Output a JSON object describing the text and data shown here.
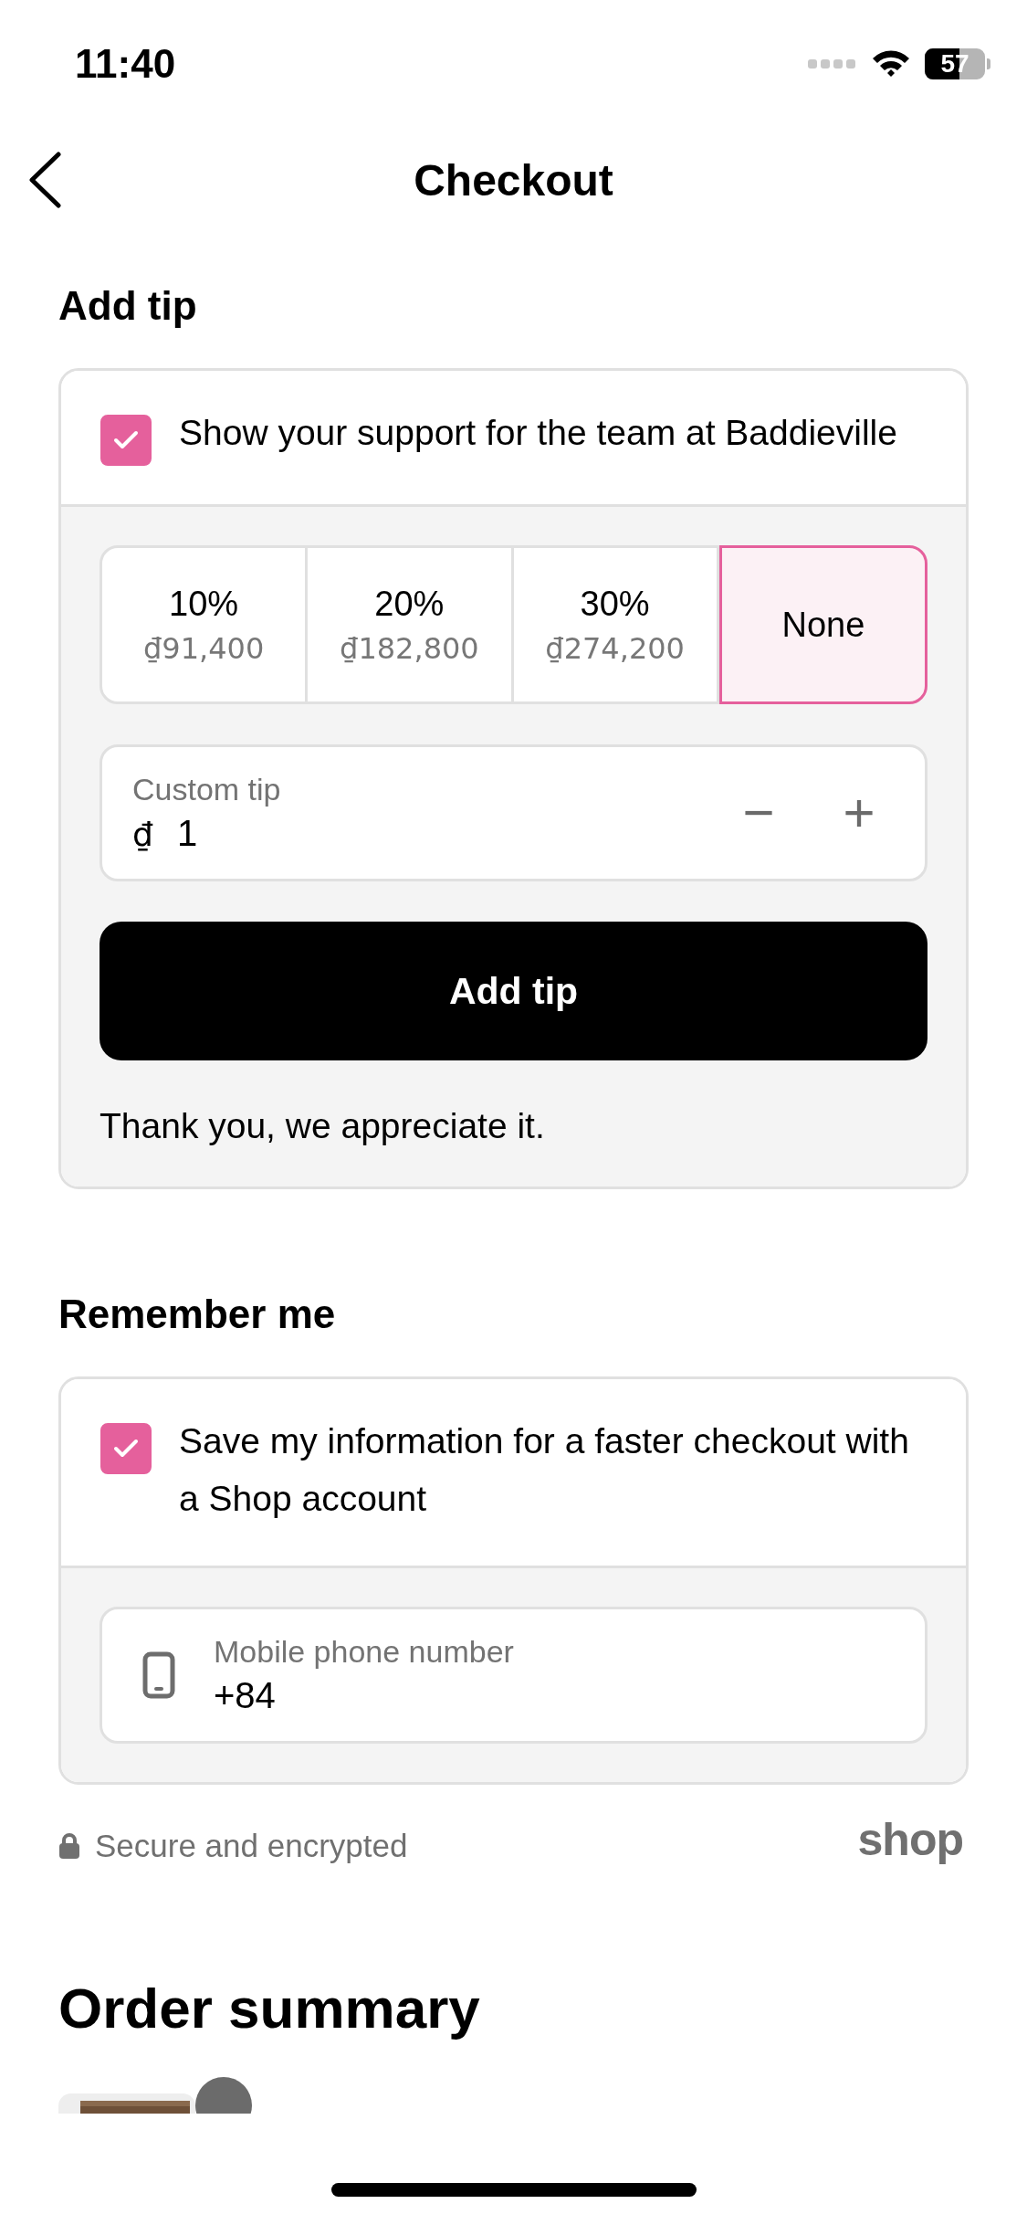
{
  "status_bar": {
    "time": "11:40",
    "battery": "57"
  },
  "header": {
    "title": "Checkout"
  },
  "tip": {
    "heading": "Add tip",
    "support": {
      "label": "Show your support for the team at Baddieville",
      "checked": true
    },
    "options": [
      {
        "percent": "10%",
        "amount": "₫91,400",
        "selected": false
      },
      {
        "percent": "20%",
        "amount": "₫182,800",
        "selected": false
      },
      {
        "percent": "30%",
        "amount": "₫274,200",
        "selected": false
      },
      {
        "percent": "None",
        "selected": true
      }
    ],
    "custom": {
      "label": "Custom tip",
      "currency": "₫",
      "value": "1",
      "decrement": "−",
      "increment": "+"
    },
    "button": "Add tip",
    "thanks": "Thank you, we appreciate it."
  },
  "remember": {
    "heading": "Remember me",
    "save": {
      "label": "Save my information for a faster checkout with a Shop account",
      "checked": true
    },
    "phone": {
      "label": "Mobile phone number",
      "value": "+84"
    }
  },
  "secure": "Secure and encrypted",
  "shop_logo": "shop",
  "order_summary": {
    "heading": "Order summary"
  }
}
